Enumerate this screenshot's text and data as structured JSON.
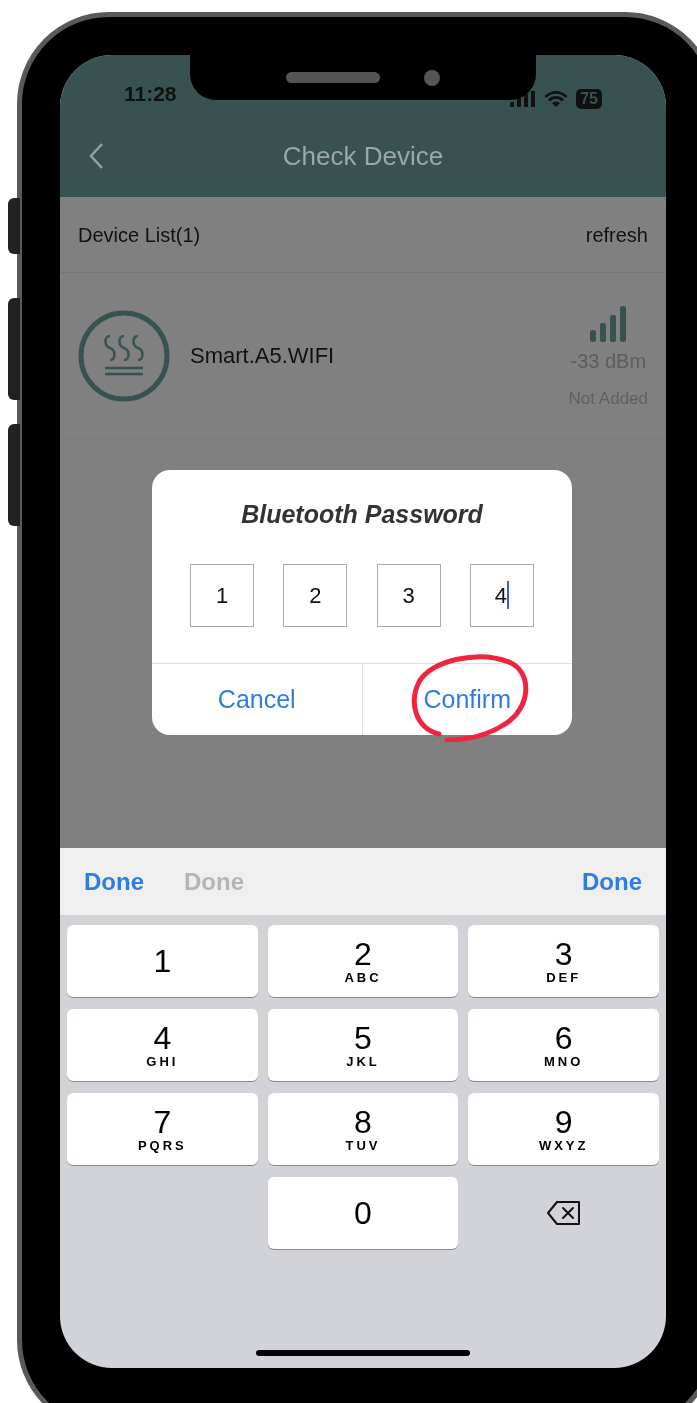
{
  "status_bar": {
    "time": "11:28",
    "battery": "75"
  },
  "header": {
    "title": "Check Device"
  },
  "list_header": {
    "label": "Device List(1)",
    "action": "refresh"
  },
  "devices": [
    {
      "name": "Smart.A5.WIFI",
      "signal": "-33 dBm",
      "status": "Not Added"
    }
  ],
  "dialog": {
    "title": "Bluetooth Password",
    "digits": [
      {
        "value": "1",
        "selected": false
      },
      {
        "value": "2",
        "selected": false
      },
      {
        "value": "3",
        "selected": false
      },
      {
        "value": "4",
        "selected": true
      }
    ],
    "buttons": [
      {
        "label": "Cancel",
        "highlighted": false
      },
      {
        "label": "Confirm",
        "highlighted": true
      }
    ]
  },
  "toolbar": [
    {
      "label": "Done",
      "disabled": false
    },
    {
      "label": "Done",
      "disabled": true
    },
    {
      "label": "Done",
      "disabled": false
    }
  ],
  "keys": [
    {
      "kind": "digit",
      "digit": "1"
    },
    {
      "kind": "digit",
      "digit": "2",
      "letters": "ABC"
    },
    {
      "kind": "digit",
      "digit": "3",
      "letters": "DEF"
    },
    {
      "kind": "digit",
      "digit": "4",
      "letters": "GHI"
    },
    {
      "kind": "digit",
      "digit": "5",
      "letters": "JKL"
    },
    {
      "kind": "digit",
      "digit": "6",
      "letters": "MNO"
    },
    {
      "kind": "digit",
      "digit": "7",
      "letters": "PQRS"
    },
    {
      "kind": "digit",
      "digit": "8",
      "letters": "TUV"
    },
    {
      "kind": "digit",
      "digit": "9",
      "letters": "WXYZ"
    },
    {
      "kind": "blank"
    },
    {
      "kind": "digit",
      "digit": "0"
    },
    {
      "kind": "delete"
    }
  ]
}
